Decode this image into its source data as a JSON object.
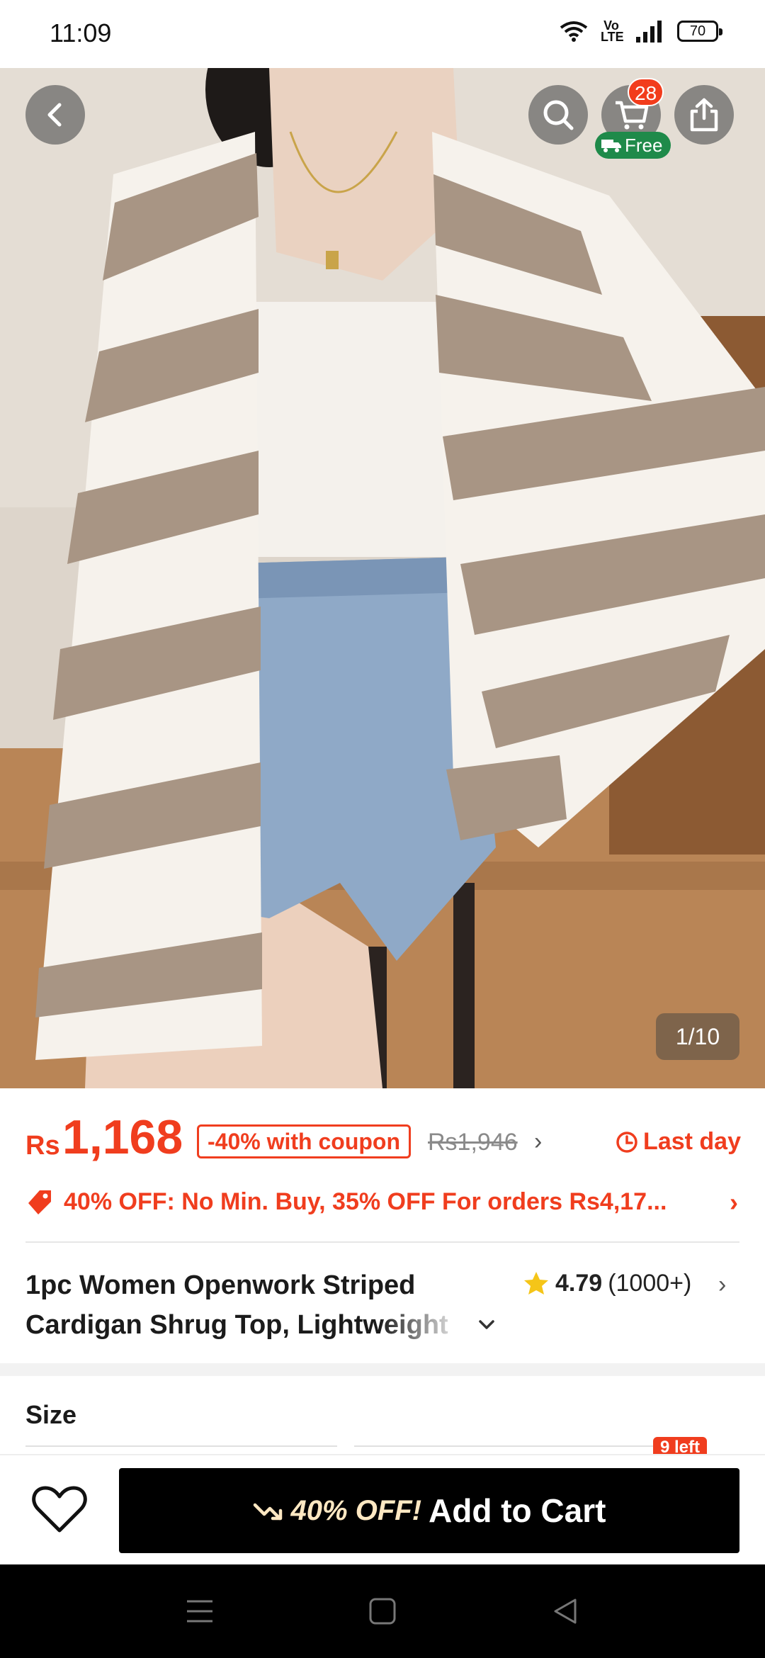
{
  "status_bar": {
    "time": "11:09",
    "network_label": "Vo LTE",
    "battery": "70"
  },
  "hero": {
    "image_counter": "1/10",
    "cart_count": "28",
    "shipping_badge": "Free",
    "icons": [
      "back-arrow-icon",
      "search-icon",
      "cart-icon",
      "truck-icon",
      "share-icon"
    ]
  },
  "price": {
    "currency": "Rs",
    "amount": "1,168",
    "coupon_text": "-40% with coupon",
    "original_price": "Rs1,946",
    "deadline": "Last day"
  },
  "promo": {
    "text": "40% OFF: No Min. Buy,  35% OFF For orders Rs4,17..."
  },
  "product": {
    "title_line1": "1pc Women Openwork Striped",
    "title_line2": "Cardigan Shrug Top, Lightweight",
    "rating": "4.79",
    "review_count": "(1000+)"
  },
  "size": {
    "label": "Size",
    "stock_badge": "9 left"
  },
  "action_bar": {
    "discount_label": "40% OFF!",
    "add_to_cart_label": "Add to Cart"
  },
  "colors": {
    "accent": "#f03d1e",
    "free_badge": "#1f8a4a",
    "button": "#000000"
  }
}
